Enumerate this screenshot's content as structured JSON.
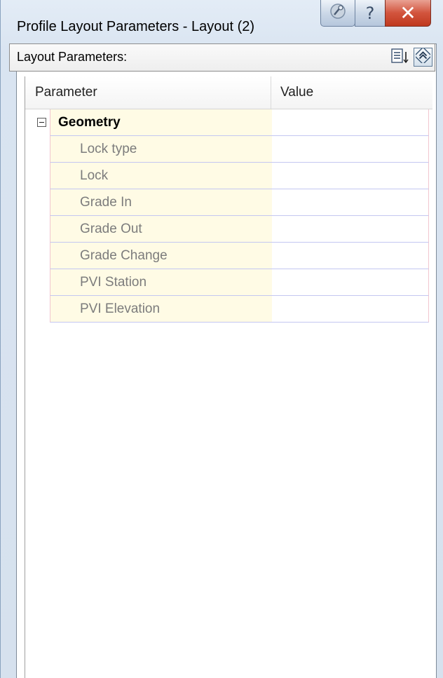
{
  "window": {
    "title": "Profile Layout Parameters - Layout (2)",
    "buttons": {
      "pin": "pin-icon",
      "help": "?",
      "close": "✕"
    }
  },
  "toolbar": {
    "label": "Layout Parameters:",
    "icons": [
      "list-sort-icon",
      "collapse-double-chevron-icon"
    ]
  },
  "table": {
    "columns": [
      "Parameter",
      "Value"
    ],
    "group": {
      "label": "Geometry",
      "expanded": true
    },
    "rows": [
      {
        "parameter": "Lock type",
        "value": ""
      },
      {
        "parameter": "Lock",
        "value": ""
      },
      {
        "parameter": "Grade In",
        "value": ""
      },
      {
        "parameter": "Grade Out",
        "value": ""
      },
      {
        "parameter": "Grade Change",
        "value": ""
      },
      {
        "parameter": "PVI Station",
        "value": ""
      },
      {
        "parameter": "PVI Elevation",
        "value": ""
      }
    ]
  },
  "colors": {
    "accent_close": "#c0391f",
    "row_name_bg": "#fffbe5",
    "row_border": "#c4c7f1",
    "row_side_border": "#f1c6cf"
  }
}
